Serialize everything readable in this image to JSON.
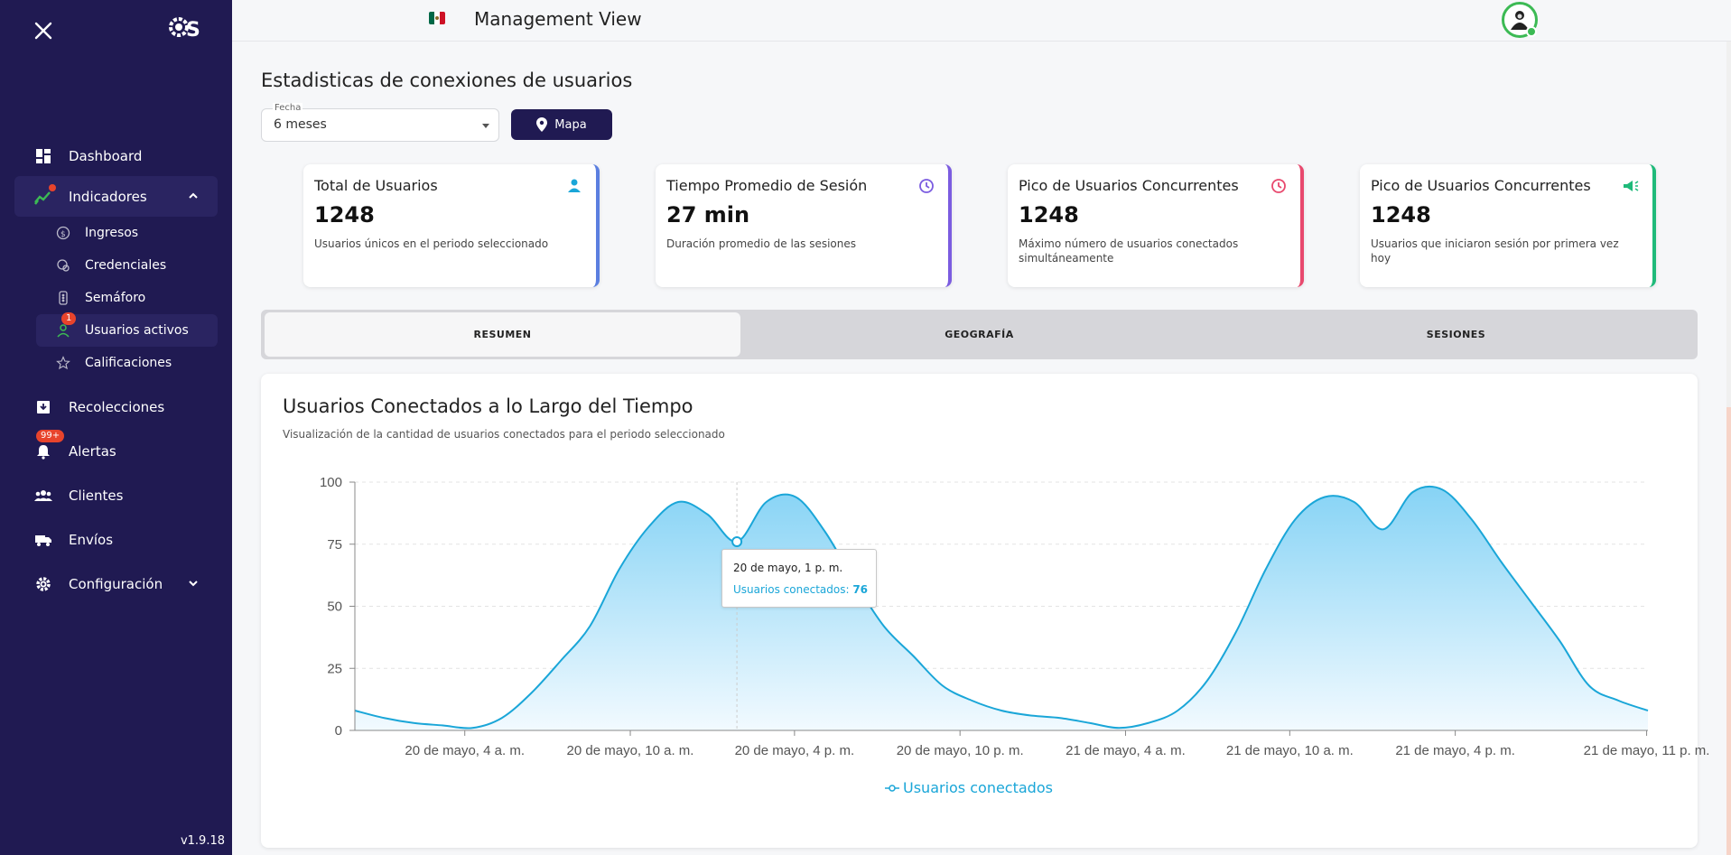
{
  "sidebar": {
    "version": "v1.9.18",
    "items": [
      {
        "label": "Dashboard",
        "icon": "dashboard-icon"
      },
      {
        "label": "Indicadores",
        "icon": "trend-icon",
        "open": true
      },
      {
        "label": "Recolecciones",
        "icon": "inbox-icon"
      },
      {
        "label": "Alertas",
        "icon": "bell-icon",
        "badge": "99+"
      },
      {
        "label": "Clientes",
        "icon": "people-icon"
      },
      {
        "label": "Envíos",
        "icon": "truck-icon"
      },
      {
        "label": "Configuración",
        "icon": "gear-icon"
      }
    ],
    "subitems": [
      {
        "label": "Ingresos",
        "icon": "dollar-icon"
      },
      {
        "label": "Credenciales",
        "icon": "credential-icon"
      },
      {
        "label": "Semáforo",
        "icon": "traffic-light-icon"
      },
      {
        "label": "Usuarios activos",
        "icon": "user-active-icon",
        "badge": "1",
        "active": true
      },
      {
        "label": "Calificaciones",
        "icon": "star-icon"
      }
    ]
  },
  "header": {
    "title": "Management View",
    "flag_colors": [
      "#006847",
      "#ffffff",
      "#ce1126"
    ]
  },
  "page": {
    "title": "Estadisticas de conexiones de usuarios",
    "filter": {
      "label": "Fecha",
      "value": "6 meses"
    },
    "map_button": "Mapa"
  },
  "cards": [
    {
      "title": "Total de Usuarios",
      "value": "1248",
      "desc": "Usuarios únicos en el periodo seleccionado",
      "accent": "#5b7fe0",
      "icon": "person-icon"
    },
    {
      "title": "Tiempo Promedio de Sesión",
      "value": "27 min",
      "desc": "Duración promedio de las sesiones",
      "accent": "#7b5ce0",
      "icon": "clock-icon"
    },
    {
      "title": "Pico de Usuarios Concurrentes",
      "value": "1248",
      "desc": "Máximo número de usuarios conectados simultáneamente",
      "accent": "#e8496e",
      "icon": "clock-icon"
    },
    {
      "title": "Pico de Usuarios Concurrentes",
      "value": "1248",
      "desc": "Usuarios que iniciaron sesión por primera vez hoy",
      "accent": "#1fba7a",
      "icon": "megaphone-icon"
    }
  ],
  "tabs": [
    {
      "label": "RESUMEN",
      "active": true
    },
    {
      "label": "GEOGRAFÍA"
    },
    {
      "label": "SESIONES"
    }
  ],
  "chart": {
    "title": "Usuarios Conectados a lo Largo del Tiempo",
    "subtitle": "Visualización de la cantidad de usuarios conectados para el periodo seleccionado",
    "tooltip": {
      "time": "20 de mayo, 1 p. m.",
      "series": "Usuarios conectados",
      "value": "76"
    }
  },
  "chart_data": {
    "type": "area",
    "x_labels": [
      "20 de mayo, 4 a. m.",
      "20 de mayo, 10 a. m.",
      "20 de mayo, 4 p. m.",
      "20 de mayo, 10 p. m.",
      "21 de mayo, 4 a. m.",
      "21 de mayo, 10 a. m.",
      "21 de mayo, 4 p. m.",
      "21 de mayo, 11 p. m."
    ],
    "y_ticks": [
      0,
      25,
      50,
      75,
      100
    ],
    "ylim": [
      0,
      100
    ],
    "grid": true,
    "legend_position": "bottom-center",
    "color": "#1aa6d8",
    "series": [
      {
        "name": "Usuarios conectados",
        "values": [
          8,
          5,
          3,
          2,
          1,
          5,
          15,
          28,
          42,
          65,
          82,
          92,
          87,
          76,
          92,
          94,
          80,
          60,
          42,
          30,
          18,
          12,
          8,
          6,
          5,
          3,
          1,
          3,
          8,
          20,
          40,
          65,
          85,
          94,
          92,
          81,
          96,
          97,
          85,
          68,
          52,
          36,
          18,
          12,
          8
        ]
      }
    ]
  }
}
